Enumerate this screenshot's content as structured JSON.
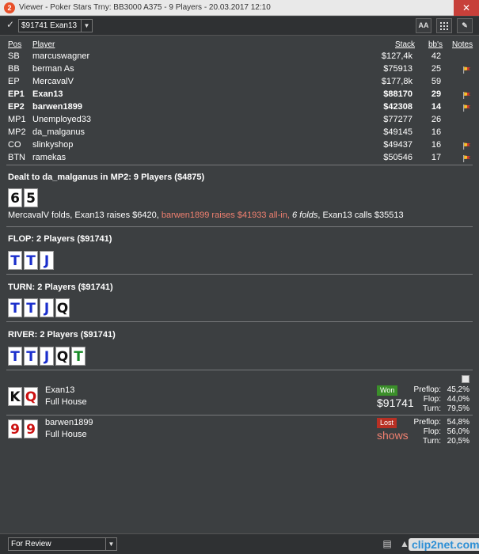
{
  "window": {
    "title": "Viewer - Poker Stars Trny: BB3000 A375 - 9 Players - 20.03.2017 12:10",
    "close_label": "✕"
  },
  "toolbar": {
    "hand_select_value": "$91741 Exan13",
    "font_button": "AA"
  },
  "table": {
    "headers": {
      "pos": "Pos",
      "player": "Player",
      "stack": "Stack",
      "bbs": "bb's",
      "notes": "Notes"
    },
    "rows": [
      {
        "pos": "SB",
        "name": "marcuswagner",
        "stack": "$127,4k",
        "bbs": "42",
        "bold": false,
        "flag": false
      },
      {
        "pos": "BB",
        "name": "berman As",
        "stack": "$75913",
        "bbs": "25",
        "bold": false,
        "flag": true
      },
      {
        "pos": "EP",
        "name": "MercavalV",
        "stack": "$177,8k",
        "bbs": "59",
        "bold": false,
        "flag": false
      },
      {
        "pos": "EP1",
        "name": "Exan13",
        "stack": "$88170",
        "bbs": "29",
        "bold": true,
        "flag": true
      },
      {
        "pos": "EP2",
        "name": "barwen1899",
        "stack": "$42308",
        "bbs": "14",
        "bold": true,
        "flag": true
      },
      {
        "pos": "MP1",
        "name": "Unemployed33",
        "stack": "$77277",
        "bbs": "26",
        "bold": false,
        "flag": false
      },
      {
        "pos": "MP2",
        "name": "da_malganus",
        "stack": "$49145",
        "bbs": "16",
        "bold": false,
        "flag": false
      },
      {
        "pos": "CO",
        "name": "slinkyshop",
        "stack": "$49437",
        "bbs": "16",
        "bold": false,
        "flag": true
      },
      {
        "pos": "BTN",
        "name": "ramekas",
        "stack": "$50546",
        "bbs": "17",
        "bold": false,
        "flag": true
      }
    ]
  },
  "preflop": {
    "label": "Dealt to da_malganus in MP2: 9 Players ($4875)",
    "cards": [
      {
        "rank": "6",
        "suit": "black"
      },
      {
        "rank": "5",
        "suit": "black"
      }
    ],
    "action_part1": "MercavalV folds, Exan13 raises $6420, ",
    "action_part2": "barwen1899 raises $41933 all-in, ",
    "action_part3": "6 folds",
    "action_part4": ", Exan13 calls $35513"
  },
  "flop": {
    "label": "FLOP: 2 Players ($91741)",
    "cards": [
      {
        "rank": "T",
        "suit": "blue"
      },
      {
        "rank": "T",
        "suit": "blue"
      },
      {
        "rank": "J",
        "suit": "blue"
      }
    ]
  },
  "turn": {
    "label": "TURN: 2 Players ($91741)",
    "cards": [
      {
        "rank": "T",
        "suit": "blue"
      },
      {
        "rank": "T",
        "suit": "blue"
      },
      {
        "rank": "J",
        "suit": "blue"
      },
      {
        "rank": "Q",
        "suit": "black"
      }
    ]
  },
  "river": {
    "label": "RIVER: 2 Players ($91741)",
    "cards": [
      {
        "rank": "T",
        "suit": "blue"
      },
      {
        "rank": "T",
        "suit": "blue"
      },
      {
        "rank": "J",
        "suit": "blue"
      },
      {
        "rank": "Q",
        "suit": "black"
      },
      {
        "rank": "T",
        "suit": "green"
      }
    ]
  },
  "results": [
    {
      "name": "Exan13",
      "hand": "Full House",
      "cards": [
        {
          "rank": "K",
          "suit": "black"
        },
        {
          "rank": "Q",
          "suit": "red"
        }
      ],
      "badge": "Won",
      "badge_type": "won",
      "amount": "$91741",
      "equity": [
        {
          "label": "Preflop:",
          "value": "45,2%"
        },
        {
          "label": "Flop:",
          "value": "44,0%"
        },
        {
          "label": "Turn:",
          "value": "79,5%"
        }
      ]
    },
    {
      "name": "barwen1899",
      "hand": "Full House",
      "cards": [
        {
          "rank": "9",
          "suit": "red"
        },
        {
          "rank": "9",
          "suit": "red"
        }
      ],
      "badge": "Lost",
      "badge_type": "lost",
      "amount": "shows",
      "equity": [
        {
          "label": "Preflop:",
          "value": "54,8%"
        },
        {
          "label": "Flop:",
          "value": "56,0%"
        },
        {
          "label": "Turn:",
          "value": "20,5%"
        }
      ]
    }
  ],
  "statusbar": {
    "review_value": "For Review"
  },
  "watermark": "clip2net.com",
  "colors": {
    "card_blue": "#1a2ecc",
    "card_red": "#cc1111",
    "card_green": "#168a26",
    "won": "#3b8f2a",
    "lost": "#b83024"
  }
}
